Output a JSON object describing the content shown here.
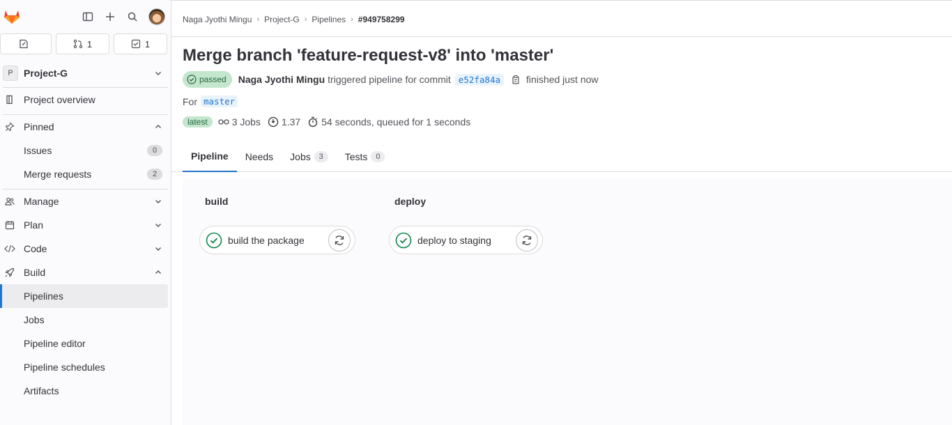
{
  "sidebar": {
    "counters": {
      "issues": "",
      "merge_requests": "1",
      "todos": "1"
    },
    "project": {
      "initial": "P",
      "name": "Project-G"
    },
    "overview": "Project overview",
    "pinned": "Pinned",
    "pinned_items": [
      {
        "label": "Issues",
        "count": "0"
      },
      {
        "label": "Merge requests",
        "count": "2"
      }
    ],
    "sections": {
      "manage": "Manage",
      "plan": "Plan",
      "code": "Code",
      "build": "Build"
    },
    "build_items": [
      "Pipelines",
      "Jobs",
      "Pipeline editor",
      "Pipeline schedules",
      "Artifacts"
    ]
  },
  "breadcrumb": [
    "Naga Jyothi Mingu",
    "Project-G",
    "Pipelines",
    "#949758299"
  ],
  "pipeline": {
    "title": "Merge branch 'feature-request-v8' into 'master'",
    "status": "passed",
    "author": "Naga Jyothi Mingu",
    "triggered_text": "triggered pipeline for commit",
    "commit": "e52fa84a",
    "finished": "finished just now",
    "for_label": "For",
    "ref": "master",
    "latest": "latest",
    "jobs": "3 Jobs",
    "compute": "1.37",
    "duration": "54 seconds, queued for 1 seconds"
  },
  "tabs": [
    {
      "label": "Pipeline",
      "count": null
    },
    {
      "label": "Needs",
      "count": null
    },
    {
      "label": "Jobs",
      "count": "3"
    },
    {
      "label": "Tests",
      "count": "0"
    }
  ],
  "stages": [
    {
      "name": "build",
      "job": "build the package"
    },
    {
      "name": "deploy",
      "job": "deploy to staging"
    }
  ],
  "colors": {
    "success": "#108548",
    "link": "#1f75cb",
    "badge_bg": "#c3e6cd"
  }
}
